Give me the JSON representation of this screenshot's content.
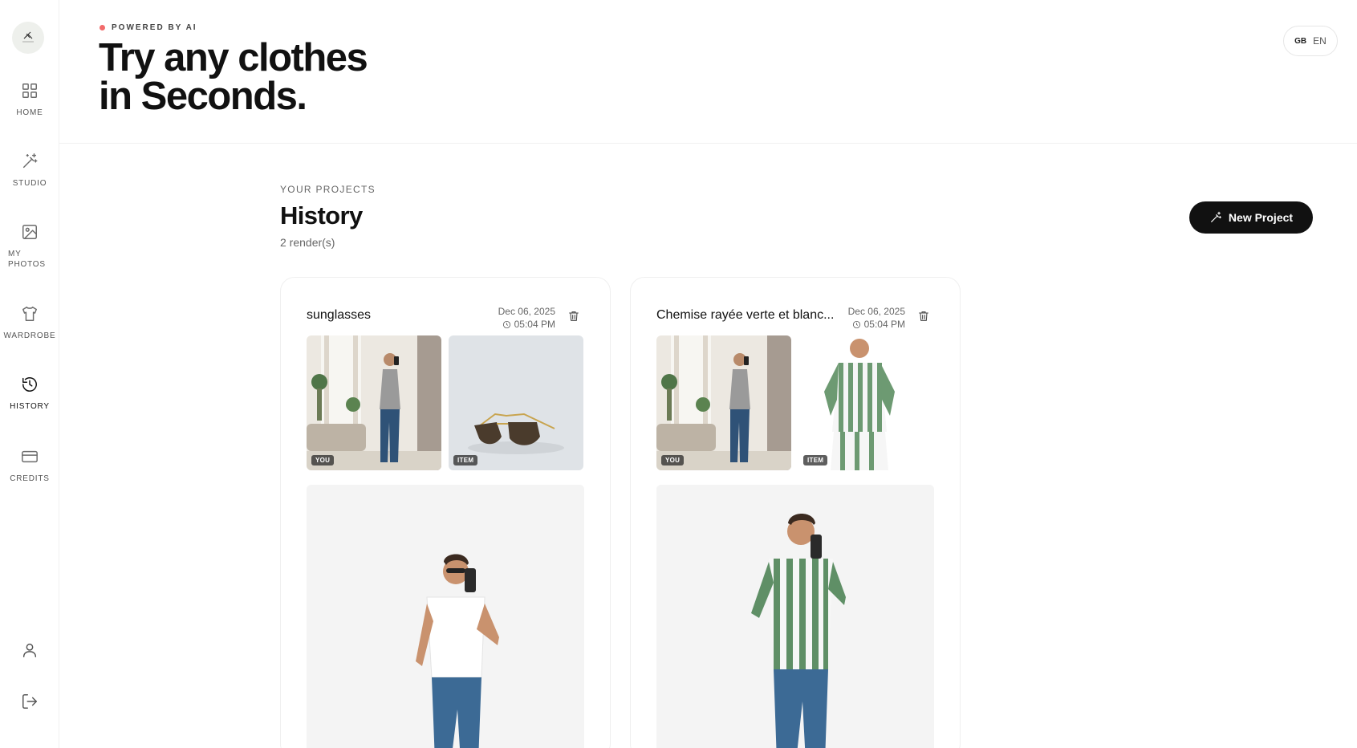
{
  "sidebar": {
    "items": [
      {
        "label": "HOME",
        "icon": "grid-icon"
      },
      {
        "label": "STUDIO",
        "icon": "magic-wand-icon"
      },
      {
        "label": "MY PHOTOS",
        "icon": "image-icon"
      },
      {
        "label": "WARDROBE",
        "icon": "tshirt-icon"
      },
      {
        "label": "HISTORY",
        "icon": "history-icon",
        "active": true
      },
      {
        "label": "CREDITS",
        "icon": "credit-card-icon"
      }
    ],
    "bottom": [
      {
        "icon": "user-icon"
      },
      {
        "icon": "logout-icon"
      }
    ]
  },
  "header": {
    "badge": "POWERED BY AI",
    "title_line1": "Try any clothes",
    "title_line2": "in Seconds.",
    "lang_flag": "GB",
    "lang_code": "EN"
  },
  "main": {
    "eyebrow": "YOUR PROJECTS",
    "title": "History",
    "count": "2 render(s)",
    "new_project_label": "New Project"
  },
  "projects": [
    {
      "title": "sunglasses",
      "date": "Dec 06, 2025",
      "time": "05:04 PM",
      "you_tag": "YOU",
      "item_tag": "ITEM"
    },
    {
      "title": "Chemise rayée verte et blanc...",
      "date": "Dec 06, 2025",
      "time": "05:04 PM",
      "you_tag": "YOU",
      "item_tag": "ITEM"
    }
  ],
  "colors": {
    "accent_dot": "#f26b6b",
    "primary_button": "#111111",
    "stripe_green": "#5f8f66"
  }
}
